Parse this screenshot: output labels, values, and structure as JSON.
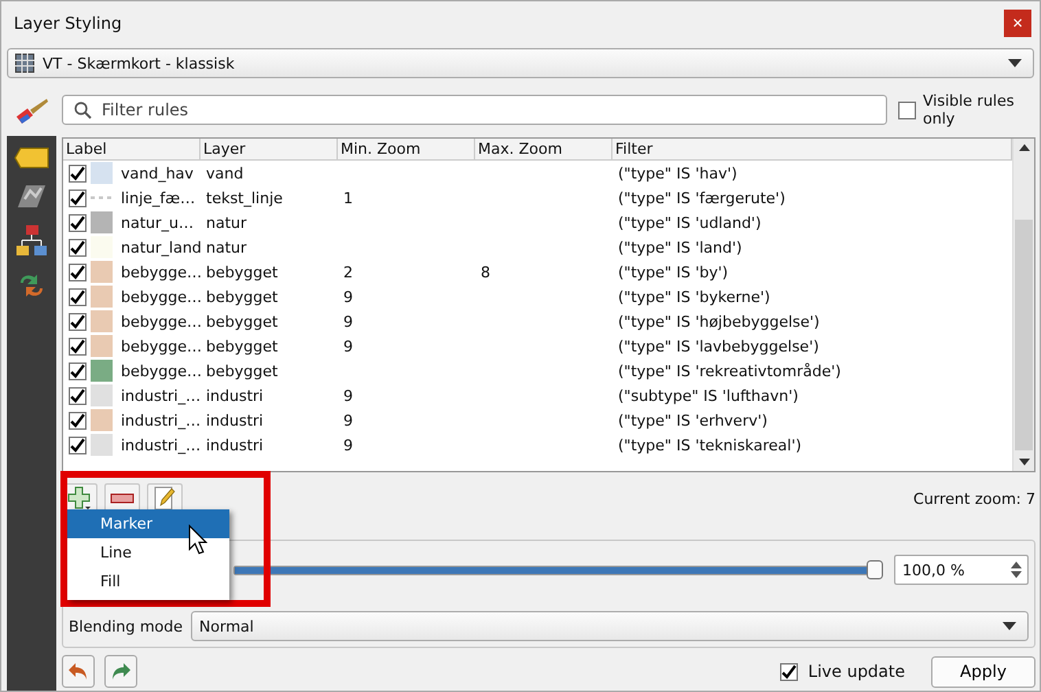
{
  "window": {
    "title": "Layer Styling",
    "close": "×"
  },
  "layer_select": {
    "value": "VT - Skærmkort - klassisk"
  },
  "filter": {
    "placeholder": "Filter rules"
  },
  "visible_rules_only": {
    "label": "Visible rules only",
    "checked": false
  },
  "table": {
    "columns": [
      "Label",
      "Layer",
      "Min. Zoom",
      "Max. Zoom",
      "Filter"
    ],
    "rows": [
      {
        "checked": true,
        "kind": "fill",
        "color": "#d6e2f0",
        "label": "vand_hav",
        "layer": "vand",
        "min_zoom": "",
        "max_zoom": "",
        "filter": "(\"type\" IS 'hav')"
      },
      {
        "checked": true,
        "kind": "line",
        "color": "#c8c8c8",
        "label": "linje_fæ…",
        "layer": "tekst_linje",
        "min_zoom": "1",
        "max_zoom": "",
        "filter": "(\"type\" IS 'færgerute')"
      },
      {
        "checked": true,
        "kind": "fill",
        "color": "#b4b4b4",
        "label": "natur_u…",
        "layer": "natur",
        "min_zoom": "",
        "max_zoom": "",
        "filter": "(\"type\" IS 'udland')"
      },
      {
        "checked": true,
        "kind": "fill",
        "color": "#fbfbef",
        "label": "natur_land",
        "layer": "natur",
        "min_zoom": "",
        "max_zoom": "",
        "filter": "(\"type\" IS 'land')"
      },
      {
        "checked": true,
        "kind": "fill",
        "color": "#e9cab2",
        "label": "bebygge…",
        "layer": "bebygget",
        "min_zoom": "2",
        "max_zoom": "8",
        "filter": "(\"type\" IS 'by')"
      },
      {
        "checked": true,
        "kind": "fill",
        "color": "#e9cab2",
        "label": "bebygge…",
        "layer": "bebygget",
        "min_zoom": "9",
        "max_zoom": "",
        "filter": "(\"type\" IS 'bykerne')"
      },
      {
        "checked": true,
        "kind": "fill",
        "color": "#e9cab2",
        "label": "bebygge…",
        "layer": "bebygget",
        "min_zoom": "9",
        "max_zoom": "",
        "filter": "(\"type\" IS 'højbebyggelse')"
      },
      {
        "checked": true,
        "kind": "fill",
        "color": "#e9cab2",
        "label": "bebygge…",
        "layer": "bebygget",
        "min_zoom": "9",
        "max_zoom": "",
        "filter": "(\"type\" IS 'lavbebyggelse')"
      },
      {
        "checked": true,
        "kind": "fill",
        "color": "#7aac84",
        "label": "bebygge…",
        "layer": "bebygget",
        "min_zoom": "",
        "max_zoom": "",
        "filter": "(\"type\" IS 'rekreativtområde')"
      },
      {
        "checked": true,
        "kind": "fill",
        "color": "#e0e0e0",
        "label": "industri_…",
        "layer": "industri",
        "min_zoom": "9",
        "max_zoom": "",
        "filter": "(\"subtype\" IS 'lufthavn')"
      },
      {
        "checked": true,
        "kind": "fill",
        "color": "#e9cab2",
        "label": "industri_…",
        "layer": "industri",
        "min_zoom": "9",
        "max_zoom": "",
        "filter": "(\"type\" IS 'erhverv')"
      },
      {
        "checked": true,
        "kind": "fill",
        "color": "#e0e0e0",
        "label": "industri_…",
        "layer": "industri",
        "min_zoom": "9",
        "max_zoom": "",
        "filter": "(\"type\" IS 'tekniskareal')"
      }
    ]
  },
  "current_zoom": "Current zoom: 7",
  "add_menu": [
    {
      "label": "Marker",
      "selected": true
    },
    {
      "label": "Line",
      "selected": false
    },
    {
      "label": "Fill",
      "selected": false
    }
  ],
  "opacity": {
    "level": 1.0,
    "reading": "100,0 %"
  },
  "blending_mode": {
    "label": "Blending mode",
    "value": "Normal"
  },
  "live_update": {
    "label": "Live update",
    "checked": true
  },
  "apply": "Apply"
}
